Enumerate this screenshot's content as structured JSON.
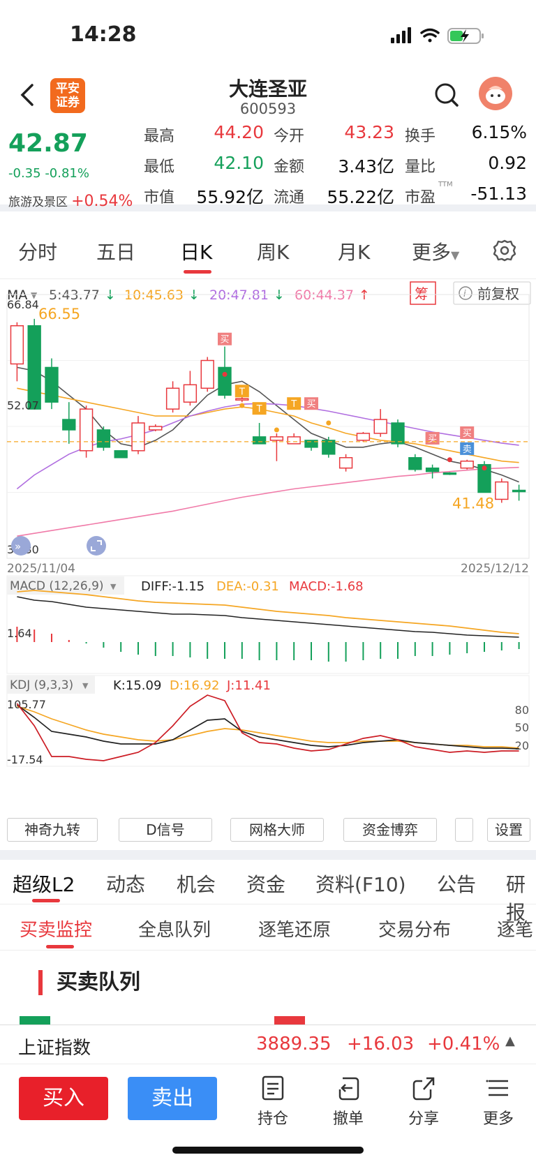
{
  "status": {
    "time": "14:28"
  },
  "header": {
    "logo": "平安\n证券",
    "title": "大连圣亚",
    "code": "600593"
  },
  "quote": {
    "price": "42.87",
    "change": "-0.35",
    "pct": "-0.81%",
    "sector_name": "旅游及景区",
    "sector_pct": "+0.54%",
    "rows": [
      [
        {
          "label": "最高",
          "value": "44.20",
          "color": "red"
        },
        {
          "label": "今开",
          "value": "43.23",
          "color": "red"
        },
        {
          "label": "换手",
          "value": "6.15%",
          "color": "black"
        }
      ],
      [
        {
          "label": "最低",
          "value": "42.10",
          "color": "green"
        },
        {
          "label": "金额",
          "value": "3.43亿",
          "color": "black"
        },
        {
          "label": "量比",
          "value": "0.92",
          "color": "black"
        }
      ],
      [
        {
          "label": "市值",
          "value": "55.92亿",
          "color": "black"
        },
        {
          "label": "流通",
          "value": "55.22亿",
          "color": "black"
        },
        {
          "label": "市盈",
          "sup": "TTM",
          "value": "-51.13",
          "color": "black"
        }
      ]
    ]
  },
  "tabs": [
    "分时",
    "五日",
    "日K",
    "周K",
    "月K",
    "更多"
  ],
  "active_tab": "日K",
  "ma": {
    "label": "MA",
    "ma5": "5:43.77",
    "ma10": "10:45.63",
    "ma20": "20:47.81",
    "ma60": "60:44.37",
    "chip": "筹",
    "adjust": "前复权"
  },
  "colors": {
    "up": "#e8383d",
    "down": "#14a05a",
    "ma5": "#555555",
    "ma10": "#f5a623",
    "ma20": "#b06ee0",
    "ma60": "#f07aa8"
  },
  "chart_data": {
    "type": "candlestick",
    "x_start": "2025/11/04",
    "x_end": "2025/12/12",
    "y_labels": [
      "66.84",
      "52.07",
      "32.30"
    ],
    "high_label": "66.55",
    "low_label": "41.48",
    "candles": [
      [
        58.0,
        63.5,
        55.5,
        64.0
      ],
      [
        63.5,
        51.5,
        51.5,
        64.5
      ],
      [
        57.5,
        52.5,
        51.5,
        58.8
      ],
      [
        50.0,
        48.5,
        46.5,
        52.5
      ],
      [
        45.5,
        51.5,
        44.5,
        52.0
      ],
      [
        48.5,
        46.0,
        45.5,
        49.0
      ],
      [
        45.5,
        44.5,
        44.5,
        45.5
      ],
      [
        45.5,
        49.5,
        45.0,
        50.5
      ],
      [
        48.5,
        49.0,
        48.3,
        49.3
      ],
      [
        51.5,
        54.5,
        51.0,
        55.5
      ],
      [
        52.5,
        55.0,
        52.0,
        57.0
      ],
      [
        54.5,
        58.5,
        54.0,
        59.0
      ],
      [
        57.5,
        53.5,
        53.0,
        60.5
      ],
      [
        53.0,
        53.0,
        52.5,
        53.5
      ],
      [
        47.5,
        46.5,
        46.5,
        49.5
      ],
      [
        47.0,
        47.5,
        44.0,
        48.0
      ],
      [
        46.5,
        47.5,
        46.5,
        48.0
      ],
      [
        47.0,
        46.0,
        45.5,
        47.0
      ],
      [
        47.0,
        45.0,
        44.5,
        47.5
      ],
      [
        43.0,
        44.5,
        42.5,
        45.0
      ],
      [
        47.0,
        48.0,
        46.8,
        48.2
      ],
      [
        48.0,
        50.0,
        47.5,
        51.5
      ],
      [
        49.5,
        46.5,
        46.0,
        50.0
      ],
      [
        44.5,
        42.8,
        42.5,
        45.0
      ],
      [
        43.0,
        42.5,
        41.5,
        43.5
      ],
      [
        42.3,
        42.2,
        42.0,
        42.4
      ],
      [
        43.0,
        44.0,
        42.8,
        44.2
      ],
      [
        43.5,
        39.5,
        39.5,
        44.0
      ],
      [
        38.5,
        41.0,
        38.0,
        41.5
      ],
      [
        39.8,
        39.6,
        38.3,
        40.6
      ]
    ],
    "ma5": [
      57.5,
      57.0,
      55.5,
      53.5,
      51.5,
      48.5,
      46.5,
      46.0,
      47.0,
      48.5,
      51.0,
      53.5,
      55.0,
      55.5,
      54.0,
      52.0,
      50.0,
      48.0,
      47.0,
      46.0,
      46.0,
      46.5,
      46.8,
      46.0,
      45.0,
      44.0,
      43.5,
      42.8,
      42.0,
      41.0
    ],
    "ma10": [
      54.5,
      54.0,
      53.5,
      53.0,
      52.5,
      52.0,
      51.5,
      51.0,
      50.5,
      50.5,
      50.5,
      51.0,
      51.5,
      51.8,
      51.5,
      51.0,
      50.5,
      49.5,
      48.8,
      48.0,
      47.5,
      47.0,
      46.8,
      46.5,
      46.0,
      45.5,
      45.0,
      44.5,
      44.0,
      43.8
    ],
    "ma20": [
      40.0,
      42.0,
      43.5,
      45.0,
      46.0,
      46.8,
      47.2,
      47.8,
      48.5,
      49.5,
      50.5,
      51.2,
      51.8,
      52.2,
      52.3,
      52.2,
      52.0,
      51.6,
      51.2,
      50.7,
      50.2,
      49.7,
      49.2,
      48.7,
      48.2,
      47.8,
      47.4,
      47.0,
      46.6,
      46.3
    ],
    "ma60": [
      33.2,
      33.6,
      34.0,
      34.4,
      34.8,
      35.2,
      35.6,
      36.0,
      36.4,
      36.8,
      37.3,
      37.8,
      38.3,
      38.8,
      39.2,
      39.6,
      40.0,
      40.3,
      40.6,
      40.9,
      41.2,
      41.5,
      41.8,
      42.0,
      42.3,
      42.5,
      42.7,
      42.9,
      43.0,
      43.1
    ],
    "ylim": [
      30,
      68
    ]
  },
  "markers": {
    "buy": "买",
    "sell": "卖",
    "t": "T"
  },
  "macd": {
    "label": "MACD (12,26,9)",
    "diff": "DIFF:-1.15",
    "dea": "DEA:-0.31",
    "val": "MACD:-1.68",
    "axis": "1.64"
  },
  "kdj": {
    "label": "KDJ (9,3,3)",
    "k": "K:15.09",
    "d": "D:16.92",
    "j": "J:11.41",
    "top": "105.77",
    "bottom": "-17.54",
    "levels": [
      "80",
      "50",
      "20"
    ]
  },
  "tools": [
    "神奇九转",
    "D信号",
    "网格大师",
    "资金博弈",
    "设置"
  ],
  "f10_tabs": [
    "超级L2",
    "动态",
    "机会",
    "资金",
    "资料(F10)",
    "公告",
    "研报"
  ],
  "sub_tabs": [
    "买卖监控",
    "全息队列",
    "逐笔还原",
    "交易分布",
    "逐笔"
  ],
  "queue_title": "买卖队列",
  "index": {
    "name": "上证指数",
    "value": "3889.35",
    "change": "+16.03",
    "pct": "+0.41%"
  },
  "bottom": {
    "buy": "买入",
    "sell": "卖出",
    "items": [
      "持仓",
      "撤单",
      "分享",
      "更多"
    ]
  }
}
